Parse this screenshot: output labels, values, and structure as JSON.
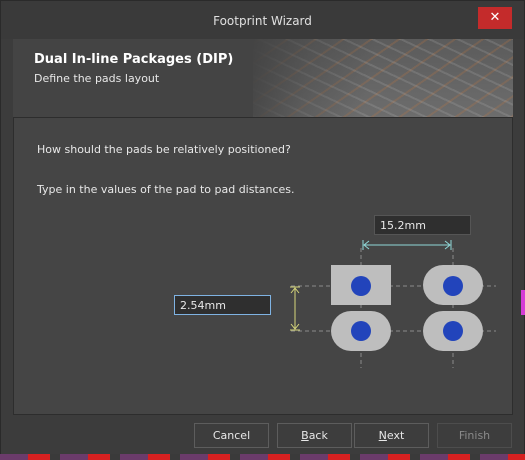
{
  "window": {
    "title": "Footprint Wizard",
    "close_symbol": "✕"
  },
  "header": {
    "title": "Dual In-line Packages (DIP)",
    "subtitle": "Define the pads layout"
  },
  "content": {
    "question1": "How should the pads be relatively positioned?",
    "question2": "Type in the values of the pad to pad distances.",
    "horizontal_distance": "15.2mm",
    "vertical_distance": "2.54mm"
  },
  "buttons": {
    "cancel": "Cancel",
    "back_mnemonic": "B",
    "back_rest": "ack",
    "next_mnemonic": "N",
    "next_rest": "ext",
    "finish": "Finish"
  },
  "colors": {
    "pad_fill": "#bebebe",
    "pad_hole": "#2244bb",
    "distance_arrow_horizontal": "#8fd6d6",
    "distance_arrow_vertical": "#d6d67a",
    "close_button": "#c42b2b"
  }
}
